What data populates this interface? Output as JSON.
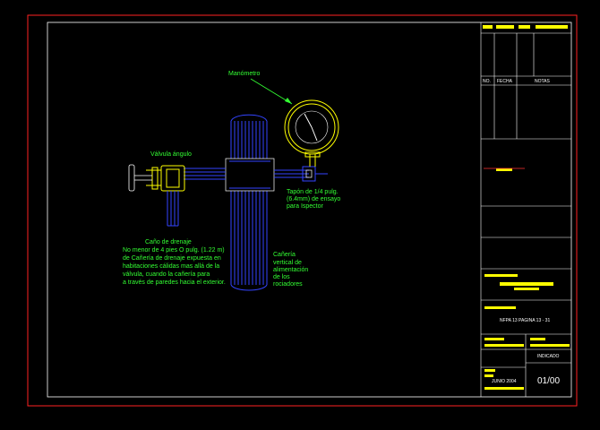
{
  "labels": {
    "manometro": "Manómetro",
    "valvula_angulo": "Válvula ángulo",
    "tapon_1": "Tapón de 1/4 pulg.",
    "tapon_2": "(6.4mm) de ensayo",
    "tapon_3": "para Ispector",
    "cano_drenaje": "Caño de drenaje",
    "nota_1": "No menor de 4 pies O pulg. (1.22 m)",
    "nota_2": "de Cañería de drenaje expuesta en",
    "nota_3": "habitaciones cálidas mas allá de la",
    "nota_4": "válvula, cuando la cañería para",
    "nota_5": "a través de paredes hacia el exterior.",
    "caneria_1": "Cañería",
    "caneria_2": "vertical de",
    "caneria_3": "alimentación",
    "caneria_4": "de los",
    "caneria_5": "rociadores"
  },
  "title_block": {
    "col_no": "NO.",
    "col_fecha": "FECHA",
    "col_notas": "NOTAS",
    "sheet_title": "NFPA 13 PAGINA 13 - 31",
    "indice_label": "INDICADO",
    "date_label": "JUNIO 2004",
    "sheet_number": "01/00"
  },
  "colors": {
    "frame_outer": "#ff2222",
    "frame_inner": "#ffffff",
    "pipe": "#3344ff",
    "valve": "#ffff00",
    "gauge": "#ffff00",
    "leader": "#33ff33",
    "text": "#33ff33"
  }
}
